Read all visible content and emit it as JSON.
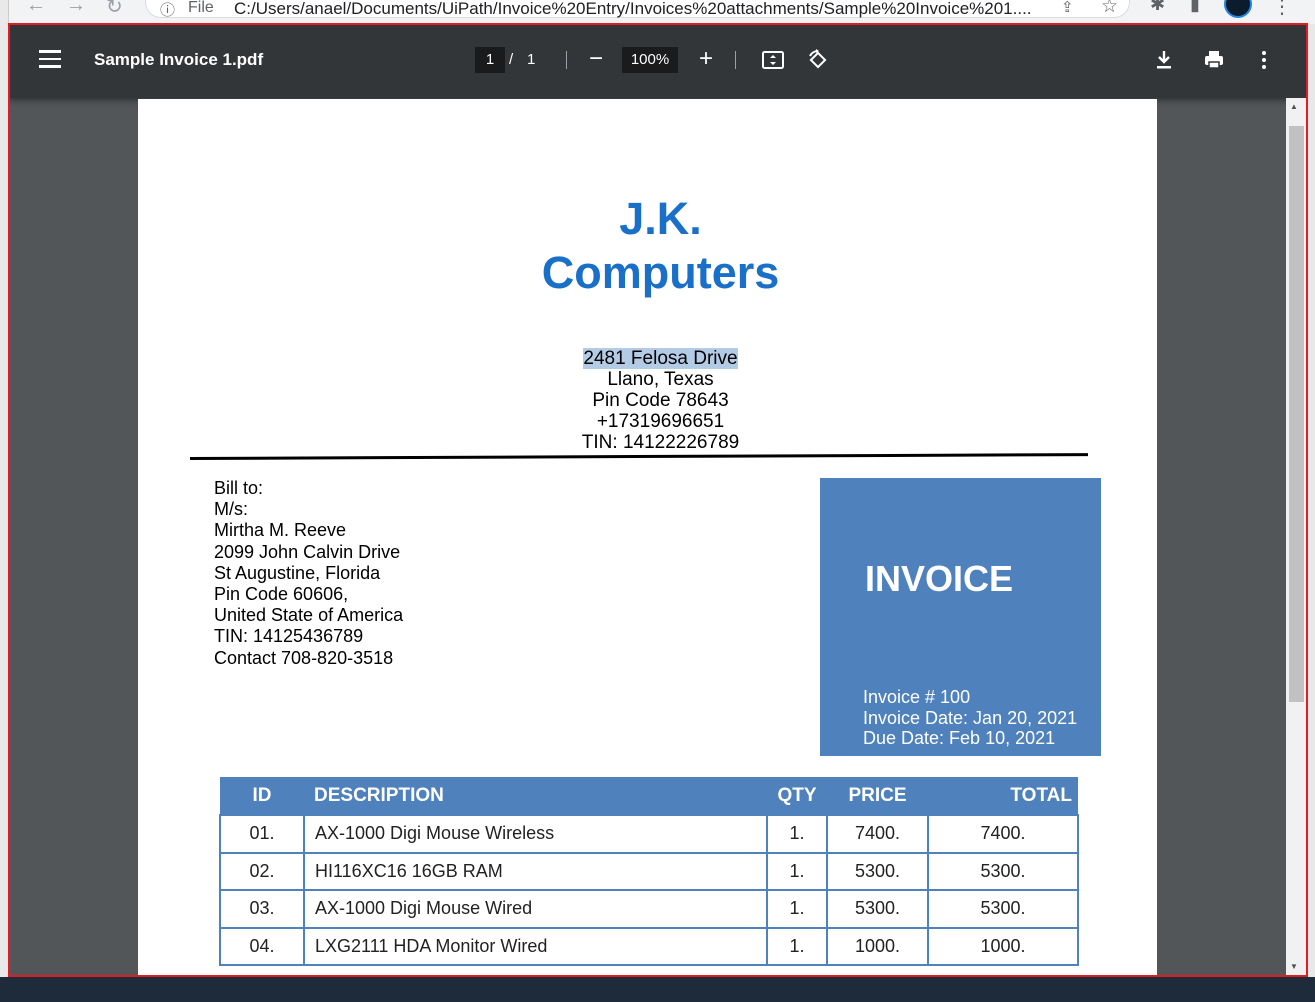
{
  "browser": {
    "back_icon": "arrow-left-icon",
    "forward_icon": "arrow-right-icon",
    "reload_icon": "reload-icon",
    "scheme_label": "File",
    "url": "C:/Users/anael/Documents/UiPath/Invoice%20Entry/Invoices%20attachments/Sample%20Invoice%201....",
    "extensions_icon": "puzzle-icon",
    "sidepanel_icon": "side-panel-icon",
    "menu_icon": "vertical-dots-icon"
  },
  "viewer": {
    "title": "Sample Invoice 1.pdf",
    "page_current": "1",
    "page_separator": "/",
    "page_total": "1",
    "zoom": "100%",
    "zoom_out_label": "−",
    "zoom_in_label": "+"
  },
  "invoice": {
    "company_line1": "J.K.",
    "company_line2": "Computers",
    "address": [
      "2481 Felosa Drive",
      "Llano, Texas",
      "Pin Code 78643",
      "+17319696651",
      "TIN: 14122226789"
    ],
    "bill_to": [
      "Bill to:",
      "M/s:",
      "Mirtha M. Reeve",
      "2099 John Calvin Drive",
      "St Augustine, Florida",
      "Pin Code  60606,",
      "United State of America",
      "TIN: 14125436789",
      "Contact 708-820-3518"
    ],
    "heading": "INVOICE",
    "invoice_number": "Invoice # 100",
    "invoice_date": "Invoice Date: Jan 20, 2021",
    "due_date": "Due Date: Feb 10, 2021",
    "columns": [
      "ID",
      "DESCRIPTION",
      "QTY",
      "PRICE",
      "TOTAL"
    ],
    "rows": [
      {
        "id": "01.",
        "desc": "AX-1000 Digi Mouse Wireless",
        "qty": "1.",
        "price": "7400.",
        "total": "7400."
      },
      {
        "id": "02.",
        "desc": "HI116XC16 16GB RAM",
        "qty": "1.",
        "price": "5300.",
        "total": "5300."
      },
      {
        "id": "03.",
        "desc": "AX-1000 Digi Mouse Wired",
        "qty": "1.",
        "price": "5300.",
        "total": "5300."
      },
      {
        "id": "04.",
        "desc": "LXG2111 HDA Monitor Wired",
        "qty": "1.",
        "price": "1000.",
        "total": "1000."
      }
    ]
  },
  "colors": {
    "company_blue": "#1a6fc9",
    "invoice_box": "#4f81bd",
    "toolbar": "#323639",
    "viewer_bg": "#525659",
    "selection_frame": "#e31b23"
  }
}
